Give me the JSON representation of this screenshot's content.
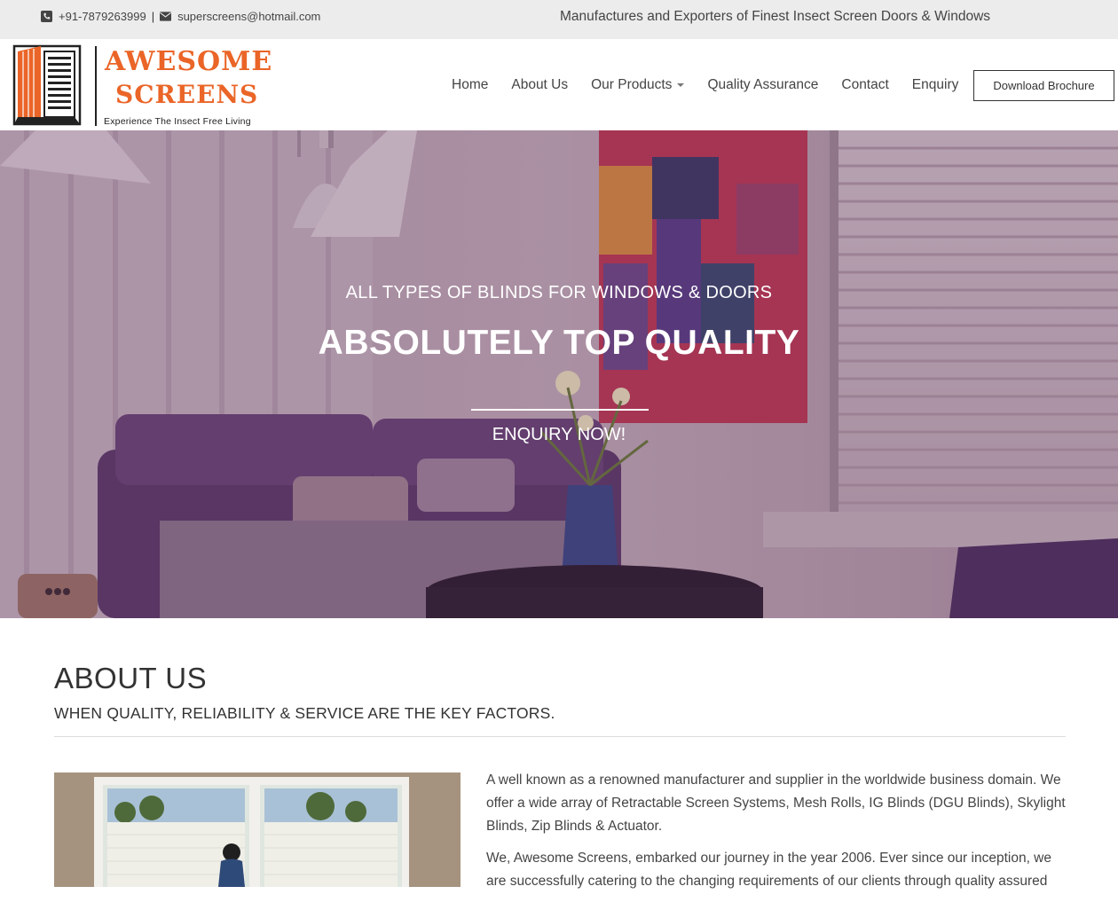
{
  "topbar": {
    "phone": "+91-7879263999",
    "separator": "|",
    "email": "superscreens@hotmail.com",
    "tagline": "Manufactures and Exporters of Finest Insect Screen Doors & Windows"
  },
  "logo": {
    "line1": "AWESOME",
    "line2": "SCREENS",
    "slogan": "Experience The Insect Free Living"
  },
  "nav": {
    "items": [
      "Home",
      "About Us",
      "Our Products",
      "Quality Assurance",
      "Contact",
      "Enquiry"
    ],
    "brochure_button": "Download Brochure"
  },
  "hero": {
    "subtitle": "ALL TYPES OF BLINDS FOR WINDOWS & DOORS",
    "title": "ABSOLUTELY TOP QUALITY",
    "cta": "ENQUIRY NOW!"
  },
  "about": {
    "title": "ABOUT US",
    "subtitle": "WHEN QUALITY, RELIABILITY & SERVICE ARE THE KEY FACTORS.",
    "paragraph1": "A well known as a renowned manufacturer and supplier in the worldwide business domain. We offer a wide array of Retractable Screen Systems, Mesh Rolls, IG Blinds (DGU Blinds), Skylight Blinds, Zip Blinds & Actuator.",
    "paragraph2": "We, Awesome Screens, embarked our journey in the year 2006. Ever since our inception, we are successfully catering to the changing requirements of our clients through quality assured"
  },
  "colors": {
    "brand_orange": "#ea6527",
    "topbar_bg": "#ececec"
  }
}
